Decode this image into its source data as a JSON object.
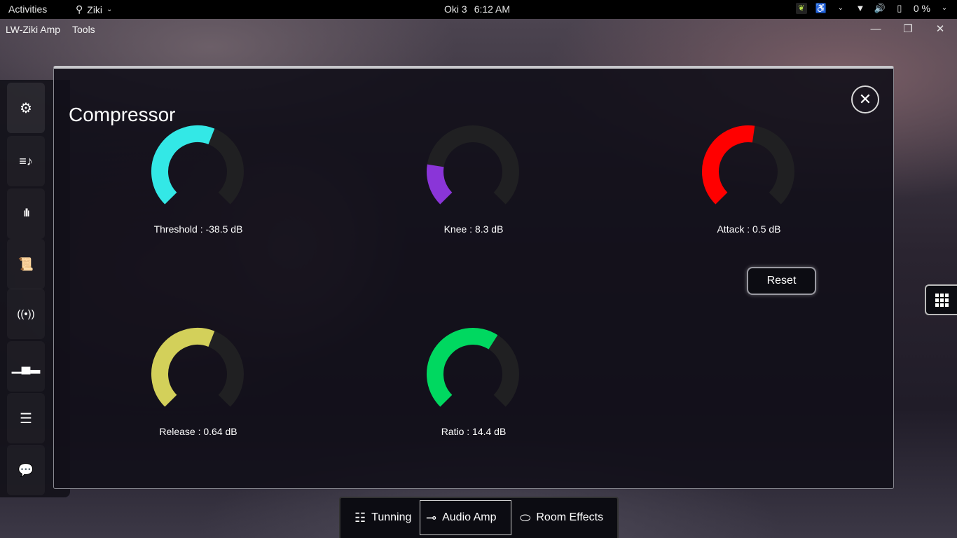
{
  "topbar": {
    "activities": "Activities",
    "app_name": "Ziki",
    "workspace": "Oki 3",
    "time": "6:12 AM",
    "battery": "0 %"
  },
  "window": {
    "title": "LW-Ziki Amp",
    "menu_tools": "Tools"
  },
  "sidebar": {
    "items": [
      {
        "icon": "gear-icon"
      },
      {
        "icon": "playlist-icon"
      },
      {
        "icon": "waveform-icon"
      },
      {
        "icon": "scroll-icon"
      },
      {
        "icon": "broadcast-icon"
      },
      {
        "icon": "bar-chart-icon"
      },
      {
        "icon": "sliders-icon"
      },
      {
        "icon": "feedback-icon"
      }
    ]
  },
  "compressor": {
    "title": "Compressor",
    "reset_label": "Reset",
    "knobs": [
      {
        "label": "Threshold : -38.5 dB",
        "fraction": 0.58,
        "color": "#33e8e6"
      },
      {
        "label": "Knee : 8.3 dB",
        "fraction": 0.2,
        "color": "#8a35d8"
      },
      {
        "label": "Attack : 0.5 dB",
        "fraction": 0.53,
        "color": "#ff0000"
      },
      {
        "label": "Release : 0.64 dB",
        "fraction": 0.58,
        "color": "#d3d05a"
      },
      {
        "label": "Ratio : 14.4 dB",
        "fraction": 0.62,
        "color": "#00d860"
      }
    ]
  },
  "tabs": {
    "tuning": "Tunning",
    "audio_amp": "Audio Amp",
    "room_effects": "Room Effects"
  }
}
